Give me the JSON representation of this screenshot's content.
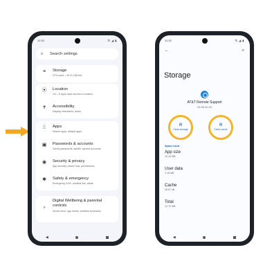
{
  "pointer_color": "#f5a623",
  "highlight_color": "#f5b22a",
  "left_phone": {
    "status": {
      "time": "11:35",
      "icons": "⇅ ◢ ▮"
    },
    "search": {
      "placeholder": "Search settings",
      "icon": "search-icon"
    },
    "groups": [
      [
        {
          "icon": "storage-icon",
          "glyph": "≡",
          "title": "Storage",
          "sub": "37% used – 40.31 GB free"
        }
      ],
      [
        {
          "icon": "location-icon",
          "glyph": "⦿",
          "title": "Location",
          "sub": "On – 5 apps have access to location"
        },
        {
          "icon": "accessibility-icon",
          "glyph": "✝",
          "title": "Accessibility",
          "sub": "Display, interaction, audio"
        }
      ],
      [
        {
          "icon": "apps-icon",
          "glyph": "⁞⁞",
          "title": "Apps",
          "sub": "Recent apps, default apps"
        },
        {
          "icon": "password-icon",
          "glyph": "▣",
          "title": "Passwords & accounts",
          "sub": "Saved passwords, autofill, synced accounts"
        },
        {
          "icon": "security-icon",
          "glyph": "◉",
          "title": "Security & privacy",
          "sub": "App security, device lock, permissions"
        },
        {
          "icon": "emergency-icon",
          "glyph": "✱",
          "title": "Safety & emergency",
          "sub": "Emergency SOS, medical info, alerts"
        }
      ],
      [
        {
          "icon": "wellbeing-icon",
          "glyph": "♆",
          "title": "Digital Wellbeing & parental controls",
          "sub": "Screen time, app timers, bedtime schedules"
        }
      ]
    ],
    "nav": {
      "back": "◀",
      "home": "home-icon",
      "recent": "recents-icon"
    }
  },
  "right_phone": {
    "status": {
      "time": "11:35",
      "icons": "⇅ ◢ ▮"
    },
    "back_glyph": "←",
    "search_glyph": "⌕",
    "title": "Storage",
    "app": {
      "name": "AT&T Remote Support",
      "version": "23.06.00.02",
      "icon": "remote-support-icon"
    },
    "actions": [
      {
        "label": "Clear storage",
        "glyph": "▤"
      },
      {
        "label": "Clear cache",
        "glyph": "▤"
      }
    ],
    "section_label": "Space used",
    "rows": [
      {
        "title": "App size",
        "value": "10.43 MB"
      },
      {
        "title": "User data",
        "value": "2.18 MB"
      },
      {
        "title": "Cache",
        "value": "28.67 kB"
      },
      {
        "title": "Total",
        "value": "12.70 MB"
      }
    ],
    "nav": {
      "back": "◀"
    }
  }
}
